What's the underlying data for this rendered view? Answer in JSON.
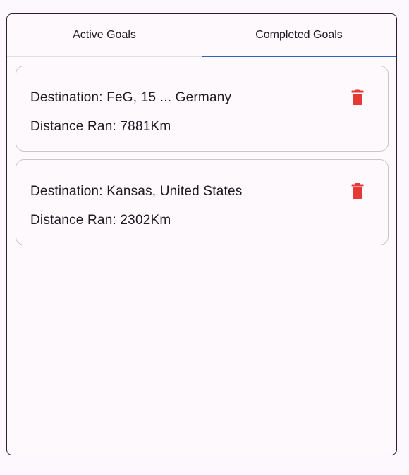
{
  "tabs": [
    {
      "label": "Active Goals",
      "active": false
    },
    {
      "label": "Completed Goals",
      "active": true
    }
  ],
  "goals": [
    {
      "destination": "Destination: FeG, 15 ... Germany",
      "distance": "Distance Ran: 7881Km"
    },
    {
      "destination": "Destination: Kansas, United States",
      "distance": "Distance Ran: 2302Km"
    }
  ],
  "colors": {
    "accent": "#2b63b8",
    "delete": "#e53935",
    "background": "#fdf8fd"
  },
  "icons": {
    "delete": "trash-icon"
  }
}
